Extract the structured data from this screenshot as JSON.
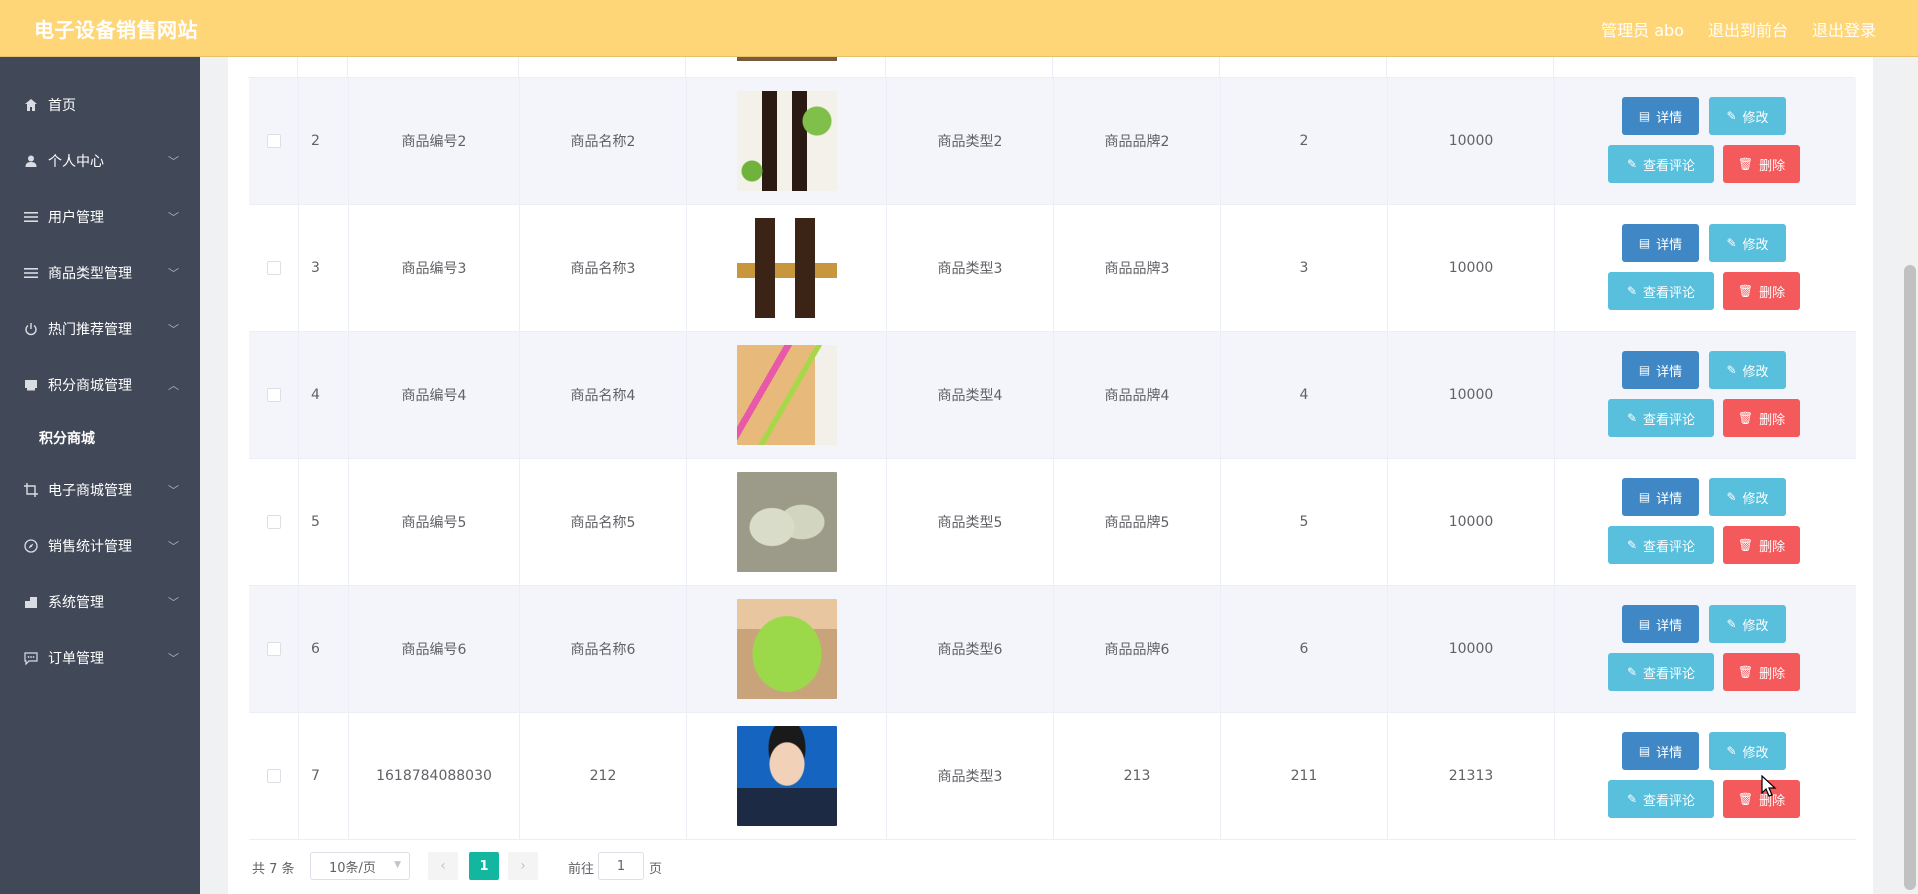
{
  "header": {
    "brand": "电子设备销售网站",
    "admin": "管理员 abo",
    "to_front": "退出到前台",
    "logout": "退出登录"
  },
  "sidebar": {
    "items": [
      {
        "label": "首页",
        "icon": "home-icon",
        "arrow": false
      },
      {
        "label": "个人中心",
        "icon": "user-icon",
        "arrow": true
      },
      {
        "label": "用户管理",
        "icon": "menu-icon",
        "arrow": true
      },
      {
        "label": "商品类型管理",
        "icon": "menu-icon",
        "arrow": true
      },
      {
        "label": "热门推荐管理",
        "icon": "power-icon",
        "arrow": true
      },
      {
        "label": "积分商城管理",
        "icon": "box-icon",
        "arrow": true,
        "expanded": true
      },
      {
        "label": "电子商城管理",
        "icon": "crop-icon",
        "arrow": true
      },
      {
        "label": "销售统计管理",
        "icon": "compass-icon",
        "arrow": true
      },
      {
        "label": "系统管理",
        "icon": "building-icon",
        "arrow": true
      },
      {
        "label": "订单管理",
        "icon": "chat-icon",
        "arrow": true
      }
    ],
    "subitem": "积分商城"
  },
  "table": {
    "rows": [
      {
        "index": "2",
        "code": "商品编号2",
        "name": "商品名称2",
        "type": "商品类型2",
        "brand": "商品品牌2",
        "col7": "2",
        "col8": "10000",
        "image": "soy-sauce-bottles"
      },
      {
        "index": "3",
        "code": "商品编号3",
        "name": "商品名称3",
        "type": "商品类型3",
        "brand": "商品品牌3",
        "col7": "3",
        "col8": "10000",
        "image": "dark-bottles"
      },
      {
        "index": "4",
        "code": "商品编号4",
        "name": "商品名称4",
        "type": "商品类型4",
        "brand": "商品品牌4",
        "col7": "4",
        "col8": "10000",
        "image": "pens"
      },
      {
        "index": "5",
        "code": "商品编号5",
        "name": "商品名称5",
        "type": "商品类型5",
        "brand": "商品品牌5",
        "col7": "5",
        "col8": "10000",
        "image": "sneakers"
      },
      {
        "index": "6",
        "code": "商品编号6",
        "name": "商品名称6",
        "type": "商品类型6",
        "brand": "商品品牌6",
        "col7": "6",
        "col8": "10000",
        "image": "green-basket"
      },
      {
        "index": "7",
        "code": "1618784088030",
        "name": "212",
        "type": "商品类型3",
        "brand": "213",
        "col7": "211",
        "col8": "21313",
        "image": "portrait"
      }
    ],
    "actions": {
      "detail": "详情",
      "edit": "修改",
      "comment": "查看评论",
      "delete": "删除"
    }
  },
  "pagination": {
    "total": "共 7 条",
    "page_size": "10条/页",
    "current_page": "1",
    "goto_label": "前往",
    "goto_value": "1",
    "page_suffix": "页"
  }
}
